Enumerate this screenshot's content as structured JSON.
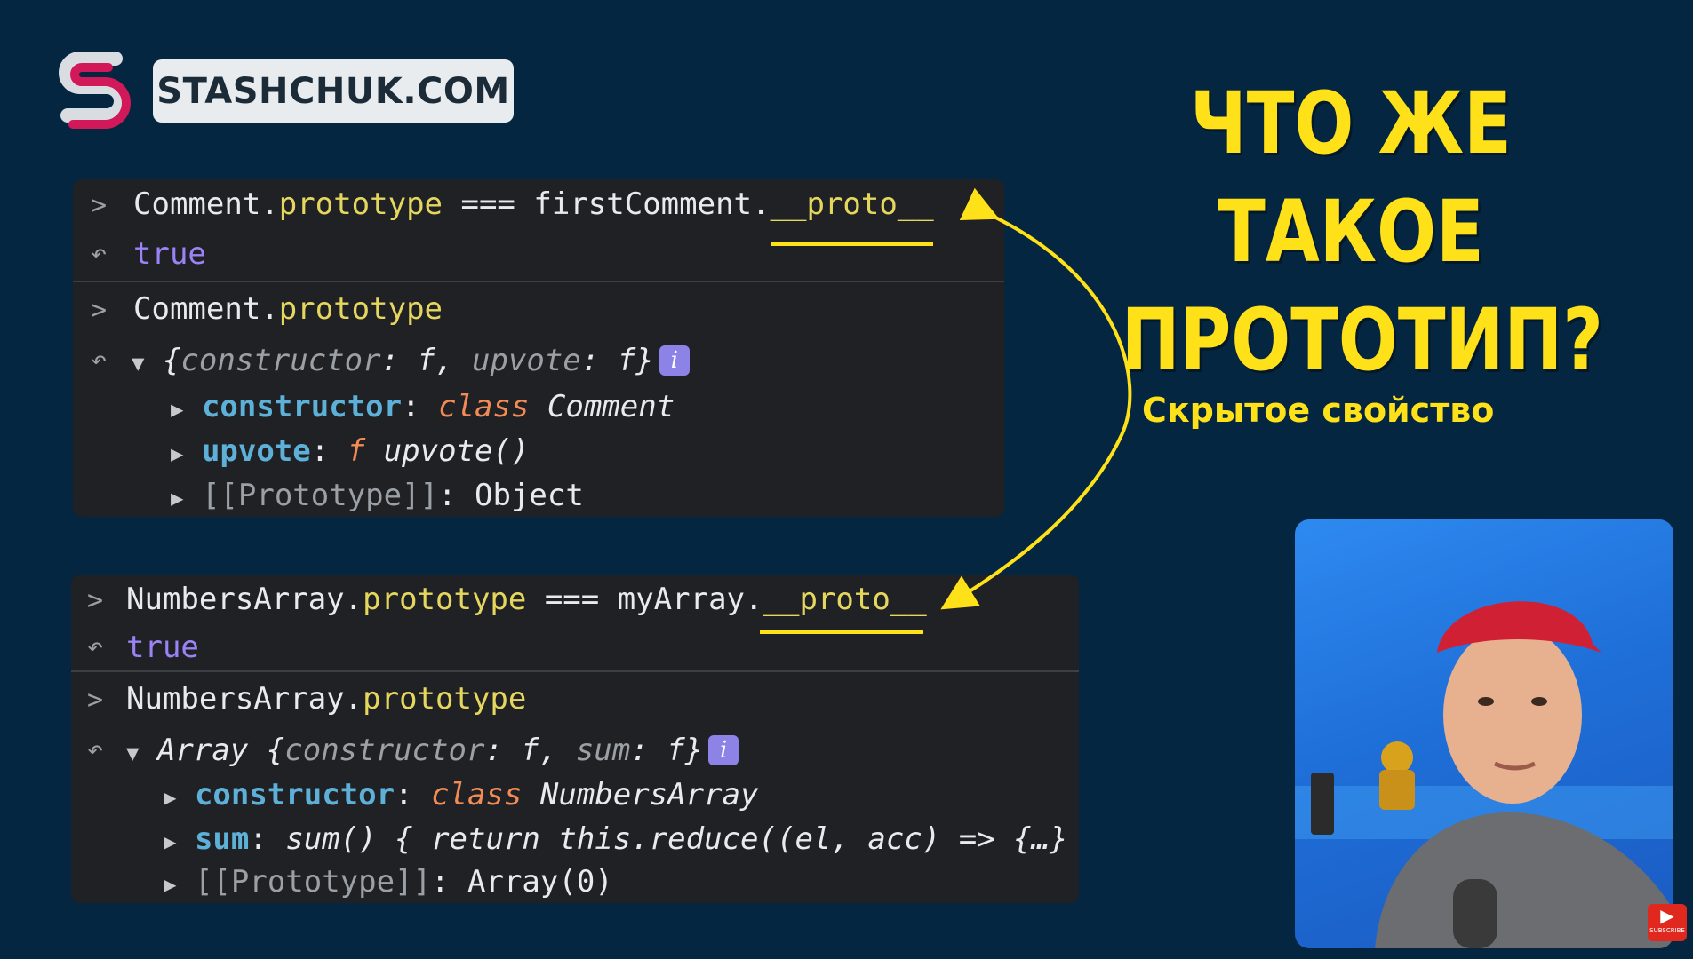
{
  "logo": {
    "text": "STASHCHUK.COM"
  },
  "title": {
    "line1": "ЧТО ЖЕ ТАКОЕ",
    "line2": "ПРОТОТИП?"
  },
  "annotation": "Скрытое свойство",
  "colors": {
    "background": "#052640",
    "accent": "#ffe11a",
    "panel": "#202124"
  },
  "console_top": {
    "line1": {
      "obj": "Comment",
      "dot": ".",
      "prop": "prototype",
      "op": " === ",
      "target": "firstComment",
      "dot2": ".",
      "proto": "__proto__"
    },
    "result1": "true",
    "line2": {
      "obj": "Comment",
      "dot": ".",
      "prop": "prototype"
    },
    "preview": {
      "open": "{",
      "k1": "constructor",
      "c1": ": ",
      "v1": "f",
      "sep": ", ",
      "k2": "upvote",
      "c2": ": ",
      "v2": "f",
      "close": "}"
    },
    "info": "i",
    "items": [
      {
        "key": "constructor",
        "colon": ": ",
        "kw": "class",
        "val": " Comment"
      },
      {
        "key": "upvote",
        "colon": ": ",
        "kw": "f",
        "val": " upvote()"
      }
    ],
    "proto_row": {
      "key": "[[Prototype]]",
      "colon": ": ",
      "val": "Object"
    }
  },
  "console_bottom": {
    "line1": {
      "obj": "NumbersArray",
      "dot": ".",
      "prop": "prototype",
      "op": " === ",
      "target": "myArray",
      "dot2": ".",
      "proto": "__proto__"
    },
    "result1": "true",
    "line2": {
      "obj": "NumbersArray",
      "dot": ".",
      "prop": "prototype"
    },
    "preview": {
      "label": "Array ",
      "open": "{",
      "k1": "constructor",
      "c1": ": ",
      "v1": "f",
      "sep": ", ",
      "k2": "sum",
      "c2": ": ",
      "v2": "f",
      "close": "}"
    },
    "info": "i",
    "items": [
      {
        "key": "constructor",
        "colon": ": ",
        "kw": "class",
        "val": " NumbersArray"
      },
      {
        "key": "sum",
        "colon": ": ",
        "val": "sum() { return this.reduce((el, acc) => {…}"
      }
    ],
    "proto_row": {
      "key": "[[Prototype]]",
      "colon": ": ",
      "val": "Array(0)"
    }
  },
  "icons": {
    "expand": "chevron-right-icon",
    "return": "return-arrow-icon",
    "collapse": "triangle-down-icon",
    "video": "youtube-subscribe-icon"
  },
  "youtube": {
    "label": "SUBSCRIBE"
  }
}
